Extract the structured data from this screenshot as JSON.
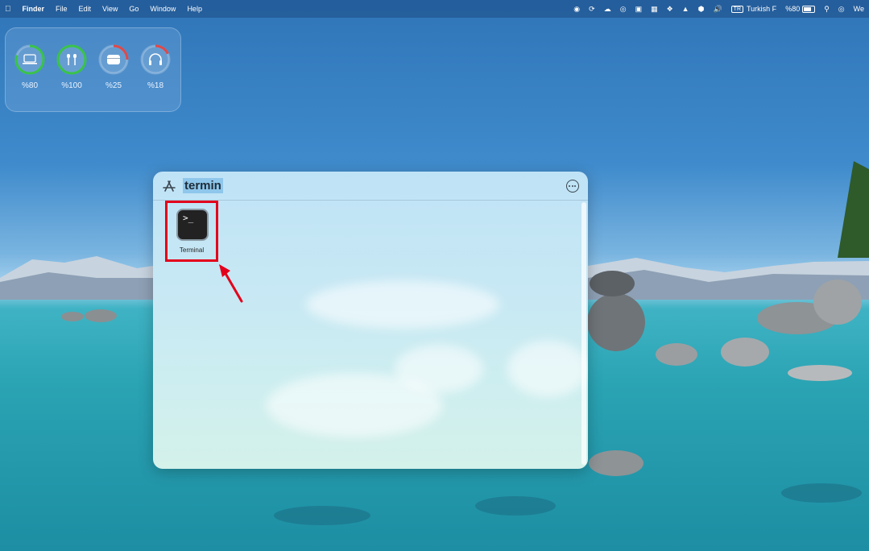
{
  "menubar": {
    "app_name": "Finder",
    "menus": [
      "File",
      "Edit",
      "View",
      "Go",
      "Window",
      "Help"
    ],
    "input_source": "Turkish F",
    "battery": "%80",
    "clock_partial": "We"
  },
  "batteries": [
    {
      "device_icon": "laptop-icon",
      "level": 80,
      "label": "%80",
      "color": "#39c24a"
    },
    {
      "device_icon": "airpods-icon",
      "level": 100,
      "label": "%100",
      "color": "#39c24a"
    },
    {
      "device_icon": "airpods-case-icon",
      "level": 25,
      "label": "%25",
      "color": "#e04848"
    },
    {
      "device_icon": "headphones-icon",
      "level": 18,
      "label": "%18",
      "color": "#e04848"
    }
  ],
  "spotlight": {
    "query": "termin",
    "results": [
      {
        "name": "Terminal",
        "icon": "terminal-icon",
        "icon_glyph": ">_"
      }
    ]
  },
  "annotation": {
    "highlight_color": "#e3001b"
  }
}
